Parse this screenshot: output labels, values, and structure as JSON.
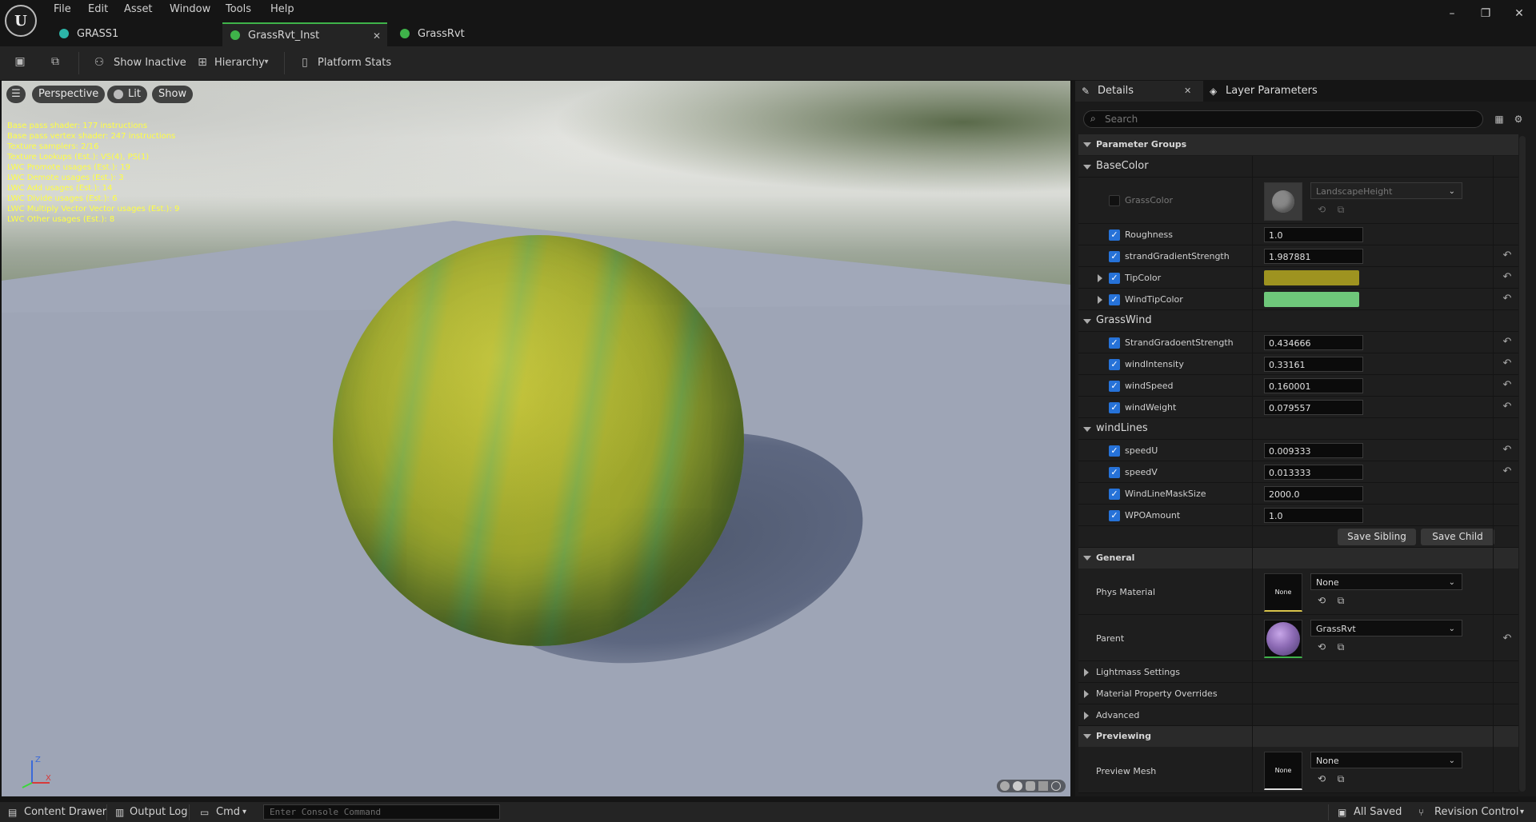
{
  "menu": [
    "File",
    "Edit",
    "Asset",
    "Window",
    "Tools",
    "Help"
  ],
  "tabs": [
    {
      "label": "GRASS1",
      "color": "#2cb5a8"
    },
    {
      "label": "GrassRvt_Inst",
      "color": "#3fb34a"
    },
    {
      "label": "GrassRvt",
      "color": "#3fb34a"
    }
  ],
  "window_controls": {
    "minimize": "–",
    "restore": "❐",
    "close": "✕"
  },
  "toolbar": {
    "show_inactive": "Show Inactive",
    "hierarchy": "Hierarchy",
    "platform_stats": "Platform Stats"
  },
  "viewport": {
    "perspective": "Perspective",
    "lit": "Lit",
    "show": "Show",
    "stats": [
      "Base pass shader: 177 instructions",
      "Base pass vertex shader: 247 instructions",
      "Texture samplers: 2/16",
      "Texture Lookups (Est.): VS(4), PS(1)",
      "LWC Promote usages (Est.): 19",
      "LWC Demote usages (Est.): 3",
      "LWC Add usages (Est.): 14",
      "LWC Divide usages (Est.): 6",
      "LWC Multiply Vector Vector usages (Est.): 9",
      "LWC Other usages (Est.): 8"
    ],
    "axis": {
      "z": "Z",
      "x": "X"
    }
  },
  "panel": {
    "details_tab": "Details",
    "layer_tab": "Layer Parameters",
    "search_placeholder": "Search",
    "parameter_groups": "Parameter Groups",
    "groups": {
      "basecolor": "BaseColor",
      "grasswind": "GrassWind",
      "windlines": "windLines"
    },
    "grass_color": {
      "label": "GrassColor",
      "dropdown": "LandscapeHeight",
      "enabled": false
    },
    "params": [
      {
        "label": "Roughness",
        "value": "1.0"
      },
      {
        "label": "strandGradientStrength",
        "value": "1.987881"
      },
      {
        "label": "TipColor",
        "color": "#9e9320"
      },
      {
        "label": "WindTipColor",
        "color": "#6ec77a"
      },
      {
        "label": "StrandGradoentStrength",
        "value": "0.434666"
      },
      {
        "label": "windIntensity",
        "value": "0.33161"
      },
      {
        "label": "windSpeed",
        "value": "0.160001"
      },
      {
        "label": "windWeight",
        "value": "0.079557"
      },
      {
        "label": "speedU",
        "value": "0.009333"
      },
      {
        "label": "speedV",
        "value": "0.013333"
      },
      {
        "label": "WindLineMaskSize",
        "value": "2000.0"
      },
      {
        "label": "WPOAmount",
        "value": "1.0"
      }
    ],
    "save_sibling": "Save Sibling",
    "save_child": "Save Child",
    "general": "General",
    "phys_material": {
      "label": "Phys Material",
      "thumb": "None",
      "value": "None"
    },
    "parent": {
      "label": "Parent",
      "value": "GrassRvt"
    },
    "lightmass": "Lightmass Settings",
    "material_overrides": "Material Property Overrides",
    "advanced": "Advanced",
    "previewing": "Previewing",
    "preview_mesh": {
      "label": "Preview Mesh",
      "thumb": "None",
      "value": "None"
    }
  },
  "bottom": {
    "content_drawer": "Content Drawer",
    "output_log": "Output Log",
    "cmd": "Cmd",
    "console_placeholder": "Enter Console Command",
    "all_saved": "All Saved",
    "revision_control": "Revision Control"
  }
}
